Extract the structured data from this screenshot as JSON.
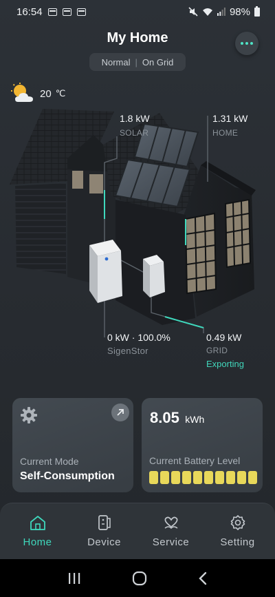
{
  "status_bar": {
    "time": "16:54",
    "battery": "98%"
  },
  "header": {
    "title": "My Home",
    "mode": "Normal",
    "separator": "|",
    "grid_state": "On Grid"
  },
  "weather": {
    "temperature": "20",
    "unit": "℃",
    "icon": "partly-cloudy-icon"
  },
  "flows": {
    "solar": {
      "value": "1.8 kW",
      "label": "SOLAR"
    },
    "home": {
      "value": "1.31 kW",
      "label": "HOME"
    },
    "storage": {
      "value": "0 kW · 100.0%",
      "label": "SigenStor"
    },
    "grid": {
      "value": "0.49 kW",
      "label": "GRID",
      "status": "Exporting"
    }
  },
  "cards": {
    "mode": {
      "label": "Current Mode",
      "value": "Self-Consumption"
    },
    "battery": {
      "value": "8.05",
      "unit": "kWh",
      "label": "Current Battery Level",
      "level_fraction": 1.0,
      "segments": 10
    }
  },
  "nav": {
    "items": [
      {
        "label": "Home",
        "icon": "home-icon"
      },
      {
        "label": "Device",
        "icon": "device-icon"
      },
      {
        "label": "Service",
        "icon": "service-icon"
      },
      {
        "label": "Setting",
        "icon": "setting-icon"
      }
    ]
  },
  "colors": {
    "accent": "#3fd9bd",
    "battery_fill": "#e8d85a",
    "background": "#2a2f34"
  }
}
